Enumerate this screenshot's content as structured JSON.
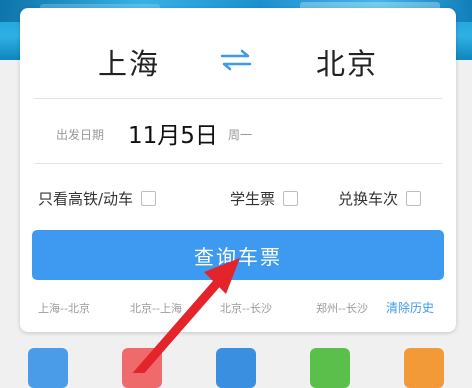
{
  "route": {
    "from": "上海",
    "to": "北京"
  },
  "date": {
    "label": "出发日期",
    "value": "11月5日",
    "weekday": "周一"
  },
  "options": [
    {
      "label": "只看高铁/动车",
      "checked": false
    },
    {
      "label": "学生票",
      "checked": false
    },
    {
      "label": "兑换车次",
      "checked": false
    }
  ],
  "search_button": {
    "label": "查询车票"
  },
  "history": {
    "items": [
      "上海--北京",
      "北京--上海",
      "北京--长沙",
      "郑州--长沙"
    ],
    "clear_label": "清除历史"
  },
  "colors": {
    "accent": "#3d9af0",
    "annotation_arrow": "#e3242b",
    "tiles": [
      "#4a9be8",
      "#ef6b6b",
      "#3a8fe0",
      "#5bbf4b",
      "#f29a38"
    ]
  },
  "annotation": {
    "type": "arrow",
    "points_to": "search-button"
  }
}
